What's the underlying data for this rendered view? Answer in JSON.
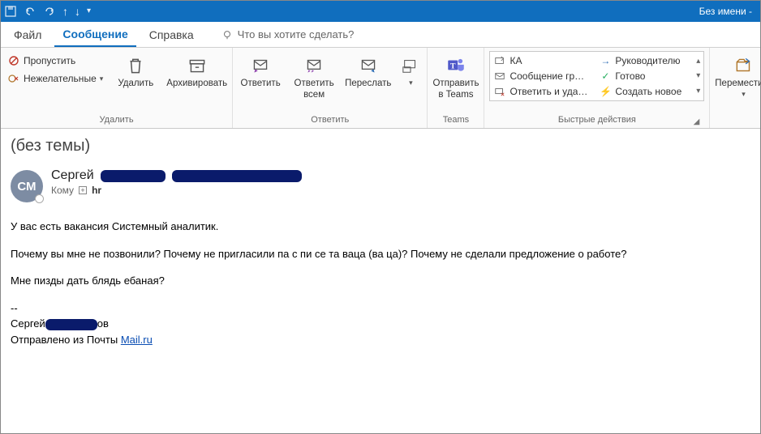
{
  "titlebar": {
    "title": "Без имени  -"
  },
  "menu": {
    "file": "Файл",
    "message": "Сообщение",
    "help": "Справка",
    "tellme": "Что вы хотите сделать?"
  },
  "ribbon": {
    "delete_group": "Удалить",
    "ignore": "Пропустить",
    "junk": "Нежелательные",
    "delete": "Удалить",
    "archive": "Архивировать",
    "respond_group": "Ответить",
    "reply": "Ответить",
    "reply_all": "Ответить\nвсем",
    "forward": "Переслать",
    "teams_group": "Teams",
    "send_teams": "Отправить\nв Teams",
    "quicksteps_group": "Быстрые действия",
    "qs": {
      "a1": "КА",
      "a2": "Сообщение гр…",
      "a3": "Ответить и уда…",
      "b1": "Руководителю",
      "b2": "Готово",
      "b3": "Создать новое"
    },
    "move": "Переместить"
  },
  "mail": {
    "subject": "(без темы)",
    "avatar_initials": "СМ",
    "sender_first": "Сергей",
    "to_label": "Кому",
    "to_value": "hr",
    "body": {
      "p1": "У вас есть вакансия Системный аналитик.",
      "p2": "Почему вы мне не позвонили? Почему не пригласили па с пи се та ваца (ва ца)? Почему не сделали предложение о работе?",
      "p3": "Мне пизды дать блядь ебаная?",
      "sig_name_prefix": "Сергей",
      "sig_suffix": "ов",
      "sig_sent_prefix": "Отправлено из Почты ",
      "sig_link": "Mail.ru"
    }
  }
}
